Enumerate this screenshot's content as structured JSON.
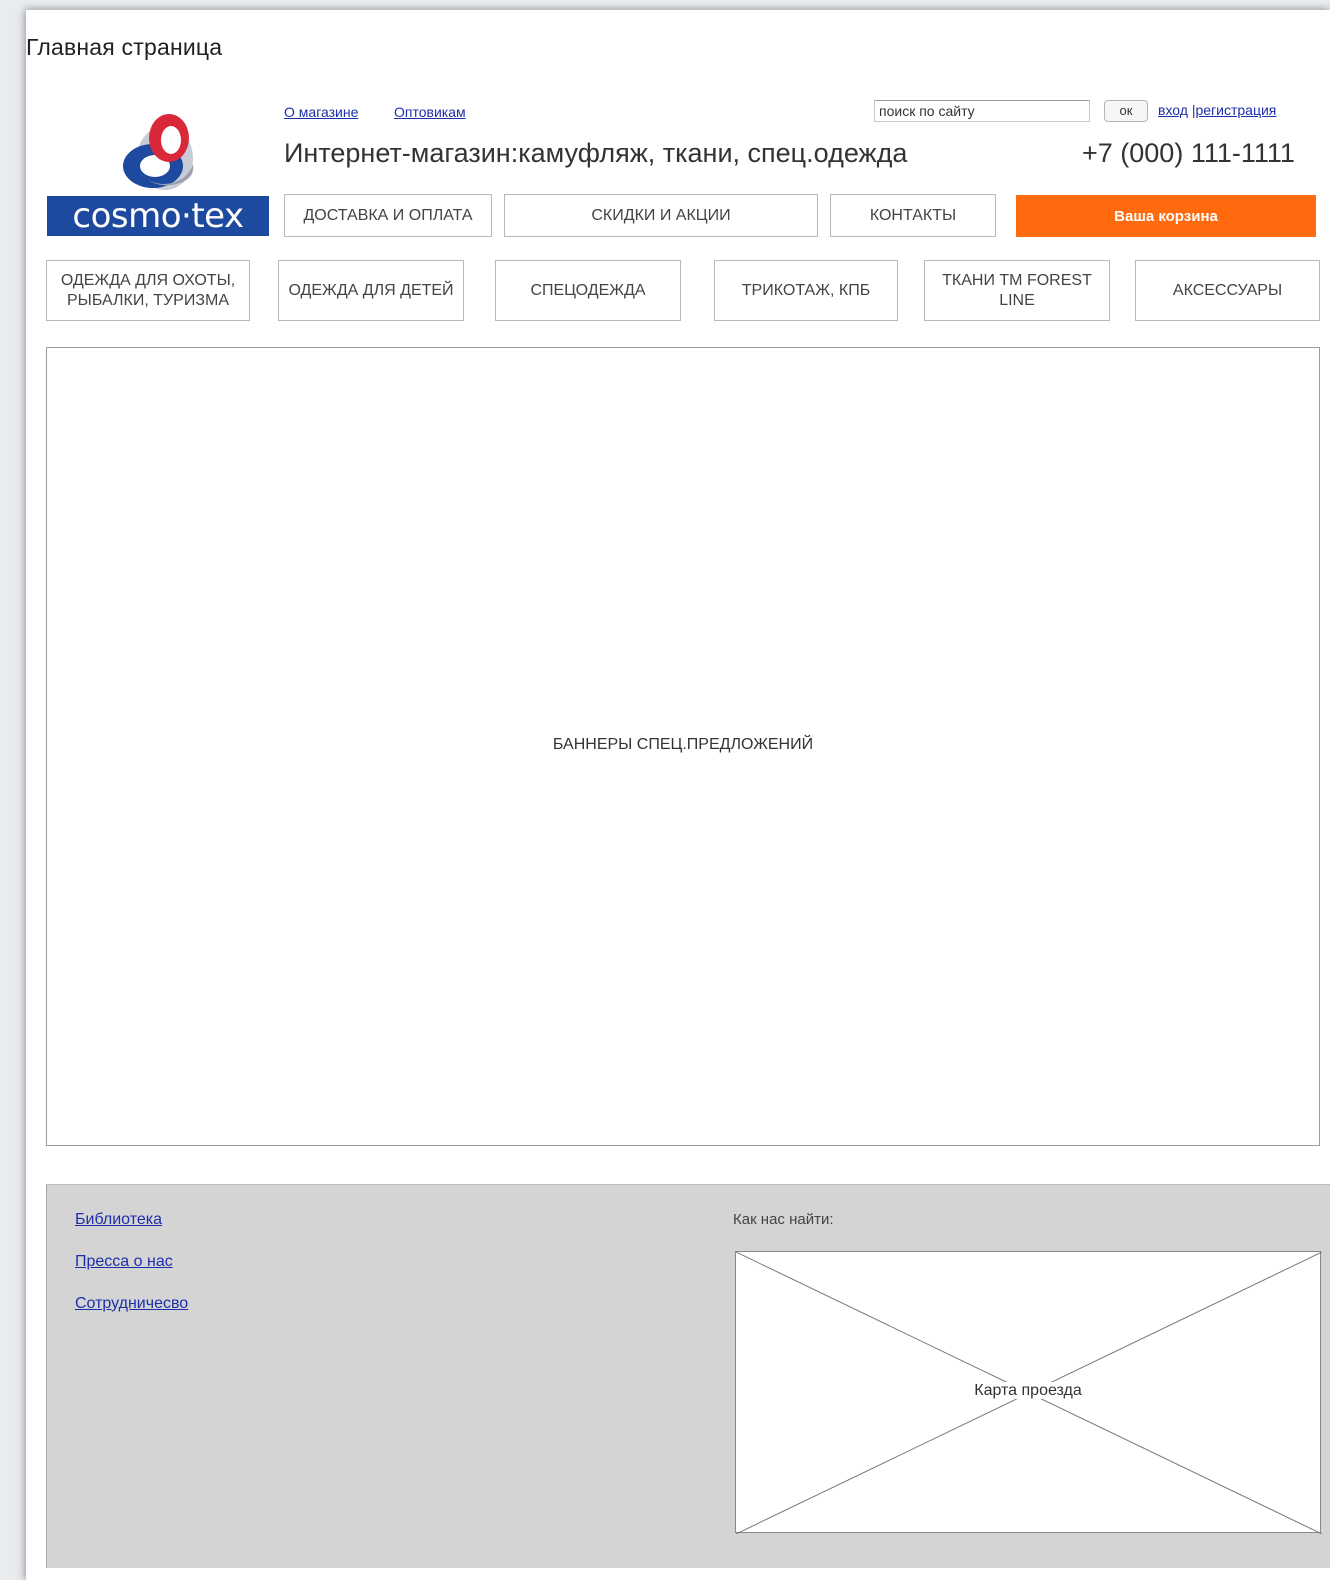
{
  "page": {
    "title": "Главная страница"
  },
  "header": {
    "logo_text": "cosmo·tex",
    "top_links": [
      "О магазине",
      "Оптовикам"
    ],
    "tagline": "Интернет-магазин:камуфляж, ткани, спец.одежда",
    "phone": "+7 (000) 111-1111",
    "search": {
      "value": "поиск по сайту",
      "button": "ок"
    },
    "auth": {
      "login": "вход",
      "separator": "|",
      "register": "регистрация"
    }
  },
  "nav": {
    "items": [
      "ДОСТАВКА И ОПЛАТА",
      "СКИДКИ И АКЦИИ",
      "КОНТАКТЫ"
    ],
    "cart": "Ваша корзина"
  },
  "categories": [
    "ОДЕЖДА ДЛЯ ОХОТЫ, РЫБАЛКИ, ТУРИЗМА",
    "ОДЕЖДА ДЛЯ ДЕТЕЙ",
    "СПЕЦОДЕЖДА",
    "ТРИКОТАЖ, КПБ",
    "ТКАНИ ТМ FOREST LINE",
    "АКСЕССУАРЫ"
  ],
  "banner": {
    "label": "БАННЕРЫ СПЕЦ.ПРЕДЛОЖЕНИЙ"
  },
  "footer": {
    "links": [
      "Библиотека",
      "Пресса о нас",
      "Сотрудничесво"
    ],
    "find_us": "Как нас найти:",
    "map_label": "Карта проезда"
  },
  "colors": {
    "cart": "#ff6a0f",
    "logo_bg": "#1d4a9e",
    "links": "#1d2fa8",
    "footer_bg": "#d4d4d4"
  }
}
